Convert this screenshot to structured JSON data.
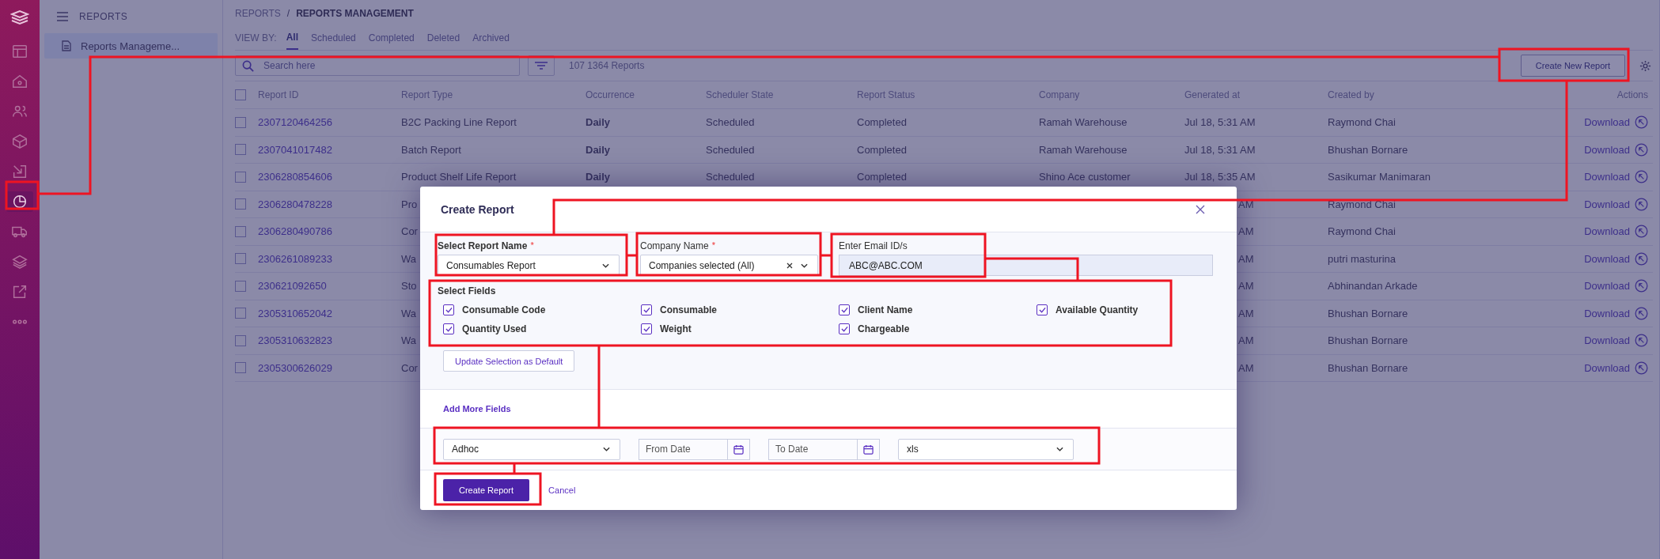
{
  "rail": {
    "items": [
      {
        "selected": false
      },
      {
        "selected": false
      },
      {
        "selected": false
      },
      {
        "selected": false
      },
      {
        "selected": false
      },
      {
        "selected": true
      },
      {
        "selected": false
      },
      {
        "selected": false
      },
      {
        "selected": false
      },
      {
        "selected": false
      }
    ]
  },
  "sidebar": {
    "title": "REPORTS",
    "items": [
      {
        "label": "Reports Manageme...",
        "selected": true
      }
    ]
  },
  "breadcrumb": {
    "parent": "REPORTS",
    "separator": "/",
    "current": "REPORTS MANAGEMENT"
  },
  "view_by": {
    "label": "VIEW BY:",
    "tabs": [
      {
        "label": "All",
        "selected": true
      },
      {
        "label": "Scheduled",
        "selected": false
      },
      {
        "label": "Completed",
        "selected": false
      },
      {
        "label": "Deleted",
        "selected": false
      },
      {
        "label": "Archived",
        "selected": false
      }
    ]
  },
  "search": {
    "placeholder": "Search here"
  },
  "count": "107 1364 Reports",
  "create_button": "Create New Report",
  "table": {
    "all_checked": false,
    "columns": [
      "Report ID",
      "Report Type",
      "Occurrence",
      "Scheduler State",
      "Report Status",
      "Company",
      "Generated at",
      "Created by",
      "Actions"
    ],
    "rows": [
      {
        "checked": false,
        "id": "2307120464256",
        "type": "B2C Packing Line Report",
        "occurrence": "Daily",
        "scheduler_state": "Scheduled",
        "status": "Completed",
        "company": "Ramah Warehouse",
        "generated_at": "Jul 18, 5:31 AM",
        "created_by": "Raymond Chai",
        "action": "Download"
      },
      {
        "checked": false,
        "id": "2307041017482",
        "type": "Batch Report",
        "occurrence": "Daily",
        "scheduler_state": "Scheduled",
        "status": "Completed",
        "company": "Ramah Warehouse",
        "generated_at": "Jul 18, 5:31 AM",
        "created_by": "Bhushan Bornare",
        "action": "Download"
      },
      {
        "checked": false,
        "id": "2306280854606",
        "type": "Product Shelf Life Report",
        "occurrence": "Daily",
        "scheduler_state": "Scheduled",
        "status": "Completed",
        "company": "Shino Ace customer",
        "generated_at": "Jul 18, 5:35 AM",
        "created_by": "Sasikumar Manimaran",
        "action": "Download"
      },
      {
        "checked": false,
        "id": "2306280478228",
        "type": "Pro",
        "generated_at": "AM",
        "created_by": "Raymond Chai",
        "action": "Download"
      },
      {
        "checked": false,
        "id": "2306280490786",
        "type": "Cor",
        "generated_at": "AM",
        "created_by": "Raymond Chai",
        "action": "Download"
      },
      {
        "checked": false,
        "id": "2306261089233",
        "type": "Wa",
        "generated_at": "AM",
        "created_by": "putri masturina",
        "action": "Download"
      },
      {
        "checked": false,
        "id": "230621092650",
        "type": "Sto",
        "generated_at": "AM",
        "created_by": "Abhinandan Arkade",
        "action": "Download"
      },
      {
        "checked": false,
        "id": "2305310652042",
        "type": "Wa",
        "generated_at": "AM",
        "created_by": "Bhushan Bornare",
        "action": "Download"
      },
      {
        "checked": false,
        "id": "2305310632823",
        "type": "Wa",
        "generated_at": "AM",
        "created_by": "Bhushan Bornare",
        "action": "Download"
      },
      {
        "checked": false,
        "id": "2305300626029",
        "type": "Cor",
        "generated_at": "AM",
        "created_by": "Bhushan Bornare",
        "action": "Download"
      }
    ]
  },
  "modal": {
    "title": "Create Report",
    "fields": [
      {
        "kind": "select",
        "label": "Select Report Name",
        "required_mark": "*",
        "value": "Consumables Report"
      },
      {
        "kind": "multiselect",
        "label": "Company Name",
        "required_mark": "*",
        "value": "Companies selected (All)"
      },
      {
        "kind": "text",
        "label": "Enter Email ID/s",
        "value": "ABC@ABC.COM"
      }
    ],
    "select_fields": {
      "label": "Select Fields",
      "options": [
        {
          "label": "Consumable Code",
          "checked": true
        },
        {
          "label": "Consumable",
          "checked": true
        },
        {
          "label": "Client Name",
          "checked": true
        },
        {
          "label": "Available Quantity",
          "checked": true
        },
        {
          "label": "Quantity Used",
          "checked": true
        },
        {
          "label": "Weight",
          "checked": true
        },
        {
          "label": "Chargeable",
          "checked": true
        }
      ]
    },
    "default_button": "Update Selection as Default",
    "add_fields_link": "Add More Fields",
    "schedule": [
      {
        "kind": "select",
        "value": "Adhoc"
      },
      {
        "kind": "date",
        "placeholder": "From Date"
      },
      {
        "kind": "date",
        "placeholder": "To Date"
      },
      {
        "kind": "select",
        "value": "xls"
      }
    ],
    "submit": "Create Report",
    "cancel": "Cancel"
  }
}
